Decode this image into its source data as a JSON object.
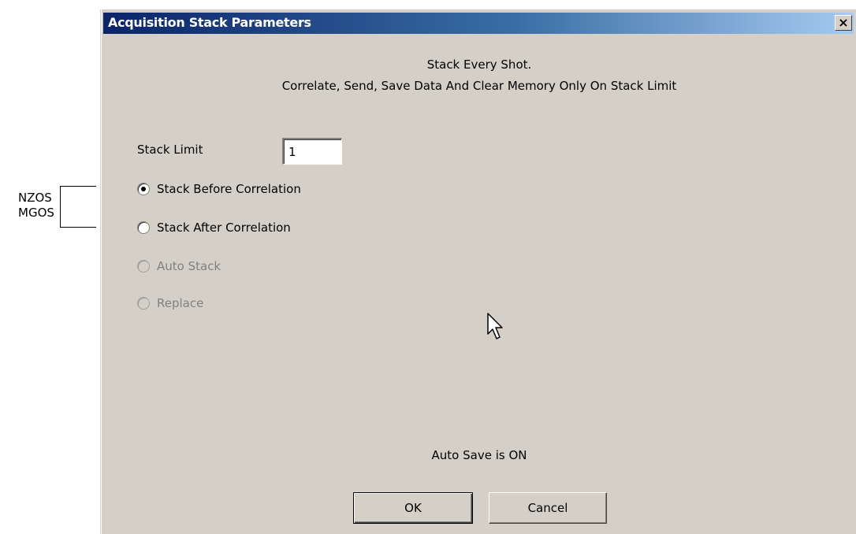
{
  "annotation": {
    "labels": [
      "NZOS",
      "MGOS"
    ]
  },
  "dialog": {
    "title": "Acquisition Stack Parameters",
    "close_glyph": "×",
    "info_line1": "Stack Every Shot.",
    "info_line2": "Correlate, Send, Save Data And Clear Memory Only On Stack Limit",
    "stack_limit": {
      "label": "Stack Limit",
      "value": "1"
    },
    "radio_options": [
      {
        "label": "Stack Before Correlation",
        "selected": true,
        "enabled": true
      },
      {
        "label": "Stack After Correlation",
        "selected": false,
        "enabled": true
      },
      {
        "label": "Auto Stack",
        "selected": false,
        "enabled": false
      },
      {
        "label": "Replace",
        "selected": false,
        "enabled": false
      }
    ],
    "auto_save_status": "Auto Save is ON",
    "buttons": {
      "ok": "OK",
      "cancel": "Cancel"
    }
  },
  "colors": {
    "dialog_bg": "#d4d0c8",
    "titlebar_start": "#0a246a",
    "titlebar_end": "#a6caf0",
    "disabled_text": "#808080"
  }
}
